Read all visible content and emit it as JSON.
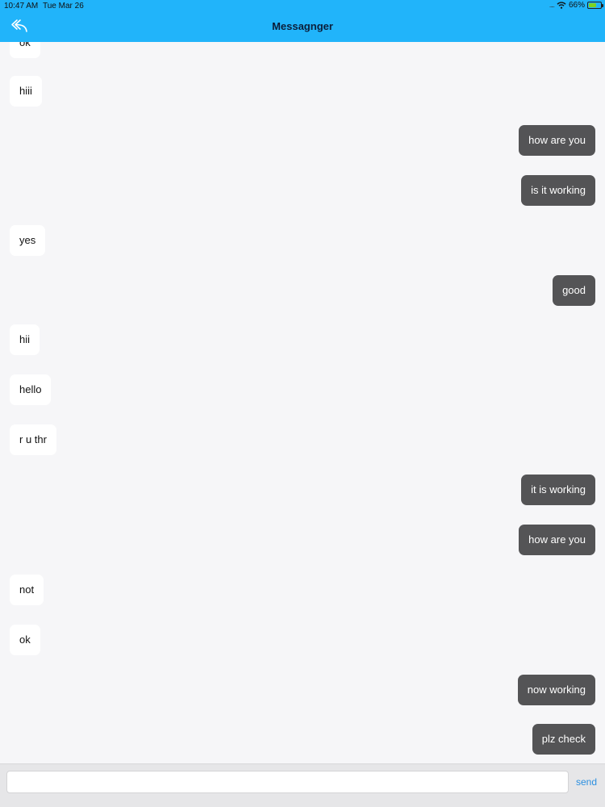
{
  "status_bar": {
    "time": "10:47 AM",
    "date": "Tue Mar 26",
    "signal": ".....",
    "battery_pct": "66%",
    "battery_level": 0.66
  },
  "nav": {
    "title": "Messagnger",
    "back_icon": "reply-arrow-icon"
  },
  "messages": [
    {
      "text": "ok",
      "direction": "in"
    },
    {
      "text": "hiii",
      "direction": "in"
    },
    {
      "text": "how are you",
      "direction": "out"
    },
    {
      "text": "is it working",
      "direction": "out"
    },
    {
      "text": "yes",
      "direction": "in"
    },
    {
      "text": "good",
      "direction": "out"
    },
    {
      "text": "hii",
      "direction": "in"
    },
    {
      "text": "hello",
      "direction": "in"
    },
    {
      "text": "r u thr",
      "direction": "in"
    },
    {
      "text": "it is working",
      "direction": "out"
    },
    {
      "text": "how are you",
      "direction": "out"
    },
    {
      "text": "not",
      "direction": "in"
    },
    {
      "text": "ok",
      "direction": "in"
    },
    {
      "text": "now working",
      "direction": "out"
    },
    {
      "text": "plz check",
      "direction": "out"
    }
  ],
  "composer": {
    "value": "",
    "send_label": "send"
  },
  "colors": {
    "header": "#21b4fa",
    "outgoing_bubble": "#545456",
    "incoming_bubble": "#ffffff"
  }
}
